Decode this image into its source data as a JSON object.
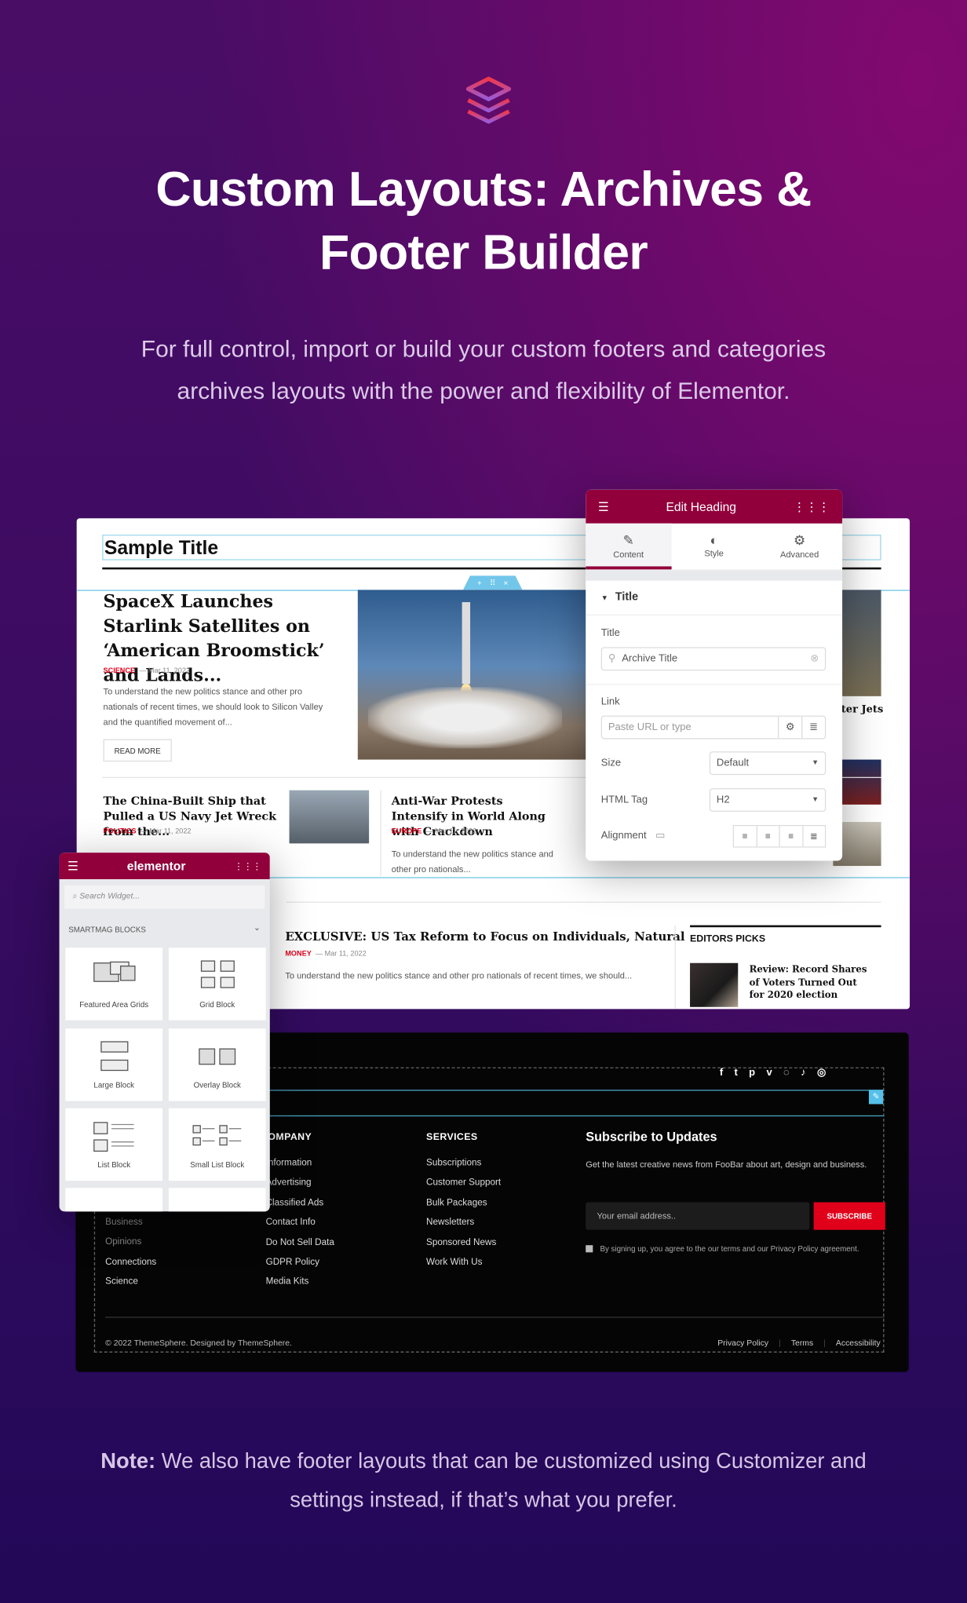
{
  "hero": {
    "title_line1": "Custom Layouts: Archives &",
    "title_line2": "Footer Builder",
    "subtitle_line1": "For full control, import or build your custom footers and categories",
    "subtitle_line2": "archives layouts with the power and flexibility of Elementor.",
    "logo_icon": "layers-icon"
  },
  "preview": {
    "sample_title": "Sample Title",
    "section_handle": {
      "add": "+",
      "move": "⠿",
      "close": "×"
    },
    "featured": {
      "title": "SpaceX Launches Starlink Satellites on ‘American Broomstick’ and Lands...",
      "category": "SCIENCE",
      "date": "— Mar 11, 2022",
      "excerpt": "To understand the new politics stance and other pro nationals of recent times, we should look to Silicon Valley and the quantified movement of...",
      "read_more": "READ MORE"
    },
    "side_partial_title": "ter Jets",
    "articles": [
      {
        "title": "The China-Built Ship that Pulled a US Navy Jet Wreck from the...",
        "category": "POLITICS",
        "date": "— Mar 11, 2022"
      },
      {
        "title": "Anti-War Protests Intensify in World Along with Crackdown",
        "category": "EUROPE",
        "date": "— Mar 11, 2022",
        "excerpt": "To understand the new politics stance and other pro nationals..."
      }
    ],
    "exclusive": {
      "title": "EXCLUSIVE: US Tax Reform to Focus on Individuals, Natural",
      "category": "MONEY",
      "date": "— Mar 11, 2022",
      "excerpt": "To understand the new politics stance and other pro nationals of recent times, we should..."
    },
    "editors_picks": {
      "heading": "EDITORS PICKS",
      "item": "Review: Record Shares of Voters Turned Out for 2020 election"
    }
  },
  "edit_panel": {
    "title": "Edit Heading",
    "tabs": [
      {
        "label": "Content",
        "icon": "pencil-icon"
      },
      {
        "label": "Style",
        "icon": "contrast-icon"
      },
      {
        "label": "Advanced",
        "icon": "gear-icon"
      }
    ],
    "section": "Title",
    "title_label": "Title",
    "title_value": "Archive Title",
    "link_label": "Link",
    "link_placeholder": "Paste URL or type",
    "size_label": "Size",
    "size_value": "Default",
    "tag_label": "HTML Tag",
    "tag_value": "H2",
    "align_label": "Alignment",
    "accent": "#92003b"
  },
  "elementor_panel": {
    "brand": "elementor",
    "search_placeholder": "Search Widget...",
    "category": "SMARTMAG BLOCKS",
    "widgets": [
      "Featured Area Grids",
      "Grid Block",
      "Large Block",
      "Overlay Block",
      "List Block",
      "Small List Block"
    ]
  },
  "footer": {
    "social": [
      "facebook-icon",
      "twitter-icon",
      "pinterest-icon",
      "vimeo-icon",
      "whatsapp-icon",
      "tiktok-icon",
      "instagram-icon"
    ],
    "col1": [
      "Business",
      "Opinions",
      "Connections",
      "Science"
    ],
    "company": {
      "heading": "COMPANY",
      "links": [
        "Information",
        "Advertising",
        "Classified Ads",
        "Contact Info",
        "Do Not Sell Data",
        "GDPR Policy",
        "Media Kits"
      ]
    },
    "services": {
      "heading": "SERVICES",
      "links": [
        "Subscriptions",
        "Customer Support",
        "Bulk Packages",
        "Newsletters",
        "Sponsored News",
        "Work With Us"
      ]
    },
    "subscribe": {
      "heading": "Subscribe to Updates",
      "text": "Get the latest creative news from FooBar about art, design and business.",
      "placeholder": "Your email address..",
      "button": "SUBSCRIBE",
      "consent": "By signing up, you agree to the our terms and our Privacy Policy agreement."
    },
    "copyright": "© 2022 ThemeSphere. Designed by ThemeSphere.",
    "bottom_links": [
      "Privacy Policy",
      "Terms",
      "Accessibility"
    ],
    "button_color": "#e1001a"
  },
  "note": {
    "bold": "Note:",
    "text": " We also have footer layouts that can be customized using Customizer and settings instead, if that’s what you prefer."
  }
}
